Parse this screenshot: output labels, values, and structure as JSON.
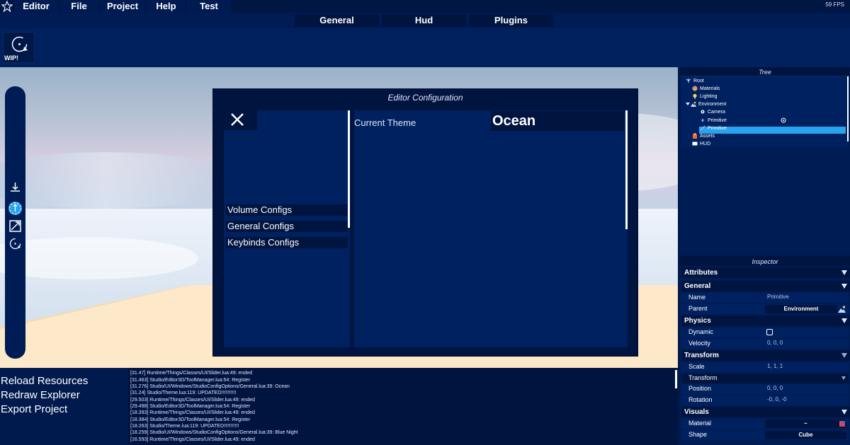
{
  "menubar": {
    "items": [
      "Editor",
      "File",
      "Project",
      "Help",
      "Test"
    ],
    "fps": "59 FPS"
  },
  "tabs": [
    "General",
    "Hud",
    "Plugins"
  ],
  "toolbar": {
    "wip_label": "WIP!"
  },
  "dialog": {
    "title": "Editor Configuration",
    "buttons": [
      "Volume Configs",
      "General Configs",
      "Keybinds Configs"
    ],
    "current_theme_label": "Current Theme",
    "current_theme_value": "Ocean"
  },
  "actions": [
    "Reload Resources",
    "Redraw Explorer",
    "Export Project"
  ],
  "console": [
    "[31.47] Runtime/Things/Classes/UI/Slider.lua:49: ended",
    "[31.463] Studio/Editor3D/ToolManager.lua:54: Register",
    "[31.276] Studio/UI/Windows/StudioConfigOptions/General.lua:39: Ocean",
    "[31.24] Studio/Theme.lua:119: UPDATED!!!!!!!!!!!",
    "[29.503] Runtime/Things/Classes/UI/Slider.lua:49: ended",
    "[29.498] Studio/Editor3D/ToolManager.lua:54: Register",
    "[18.393] Runtime/Things/Classes/UI/Slider.lua:49: ended",
    "[18.384] Studio/Editor3D/ToolManager.lua:54: Register",
    "[18.263] Studio/Theme.lua:119: UPDATED!!!!!!!!!!!",
    "[18.259] Studio/UI/Windows/StudioConfigOptions/General.lua:39: Blue Night",
    "[16.593] Runtime/Things/Classes/UI/Slider.lua:49: ended"
  ],
  "tree": {
    "title": "Tree",
    "items": [
      "Root",
      "Materials",
      "Lighting",
      "Environment",
      "Camera",
      "Primitive",
      "Primitive",
      "Assets",
      "HUD"
    ]
  },
  "inspector": {
    "title": "Inspector",
    "sections": {
      "attributes": "Attributes",
      "general": "General",
      "physics": "Physics",
      "transform": "Transform",
      "visuals": "Visuals"
    },
    "props": {
      "name_label": "Name",
      "name_value": "Primitive",
      "parent_label": "Parent",
      "parent_value": "Environment",
      "dynamic_label": "Dynamic",
      "velocity_label": "Velocity",
      "velocity_value": "0, 0, 0",
      "scale_label": "Scale",
      "scale_value": "1, 1, 1",
      "transform_label": "Transform",
      "position_label": "Position",
      "position_value": "0, 0, 0",
      "rotation_label": "Rotation",
      "rotation_value": "-0, 0, -0",
      "material_label": "Material",
      "material_value": "~",
      "shape_label": "Shape",
      "shape_value": "Cube"
    }
  },
  "colors": {
    "background": "#001a4d",
    "panel": "#001440",
    "selection": "#2aa3ee"
  }
}
